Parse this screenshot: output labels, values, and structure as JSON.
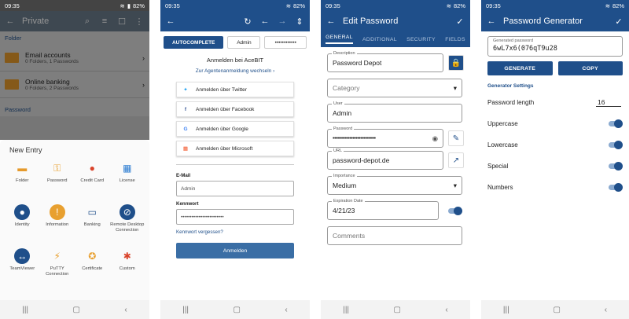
{
  "status": {
    "time": "09:35",
    "battery": "82%"
  },
  "screen1": {
    "title": "Private",
    "sections": {
      "folder": "Folder",
      "password": "Password"
    },
    "folders": [
      {
        "name": "Email accounts",
        "info": "0 Folders, 1 Passwords"
      },
      {
        "name": "Online banking",
        "info": "0 Folders, 2 Passwords"
      }
    ],
    "sheet_title": "New Entry",
    "entries": [
      {
        "label": "Folder",
        "icon": "folder-icon",
        "color": "#e59a2c"
      },
      {
        "label": "Password",
        "icon": "key-icon",
        "color": "#e8a030"
      },
      {
        "label": "Credit Card",
        "icon": "credit-card-icon",
        "color": "#d9432b"
      },
      {
        "label": "License",
        "icon": "windows-logo-icon",
        "color": "#2d7dd2"
      },
      {
        "label": "Identity",
        "icon": "person-icon",
        "color": "#1f4f8a"
      },
      {
        "label": "Information",
        "icon": "info-exclamation-icon",
        "color": "#e8a030"
      },
      {
        "label": "Banking",
        "icon": "bank-card-icon",
        "color": "#1f4f8a"
      },
      {
        "label": "Remote Desktop\nConnection",
        "icon": "remote-desktop-icon",
        "color": "#1f4f8a"
      },
      {
        "label": "TeamViewer",
        "icon": "teamviewer-icon",
        "color": "#1f4f8a"
      },
      {
        "label": "PuTTY\nConnection",
        "icon": "putty-icon",
        "color": "#e8a030"
      },
      {
        "label": "Certificate",
        "icon": "certificate-icon",
        "color": "#e8a030"
      },
      {
        "label": "Custom",
        "icon": "custom-icon",
        "color": "#d9432b"
      }
    ]
  },
  "screen2": {
    "tab_autocomplete": "AUTOCOMPLETE",
    "tab_user": "Admin",
    "tab_password": "••••••••••••",
    "heading": "Anmelden bei AceBIT",
    "switch_link": "Zur Agentenanmeldung wechseln",
    "social": [
      {
        "label": "Anmelden über Twitter",
        "icon": "twitter-icon"
      },
      {
        "label": "Anmelden über Facebook",
        "icon": "facebook-icon"
      },
      {
        "label": "Anmelden über Google",
        "icon": "google-icon"
      },
      {
        "label": "Anmelden über Microsoft",
        "icon": "microsoft-icon"
      }
    ],
    "email_label": "E-Mail",
    "email_value": "Admin",
    "password_label": "Kennwort",
    "password_value": "••••••••••••••••••••••••",
    "forgot_link": "Kennwort vergessen?",
    "submit": "Anmelden"
  },
  "screen3": {
    "title": "Edit Password",
    "tabs": [
      "GENERAL",
      "ADDITIONAL",
      "SECURITY",
      "FIELDS"
    ],
    "description_label": "Description",
    "description": "Password Depot",
    "category_placeholder": "Category",
    "user_label": "User",
    "user": "Admin",
    "password_label": "Password",
    "password_mask": "••••••••••••••••••••••••••••",
    "url_label": "URL",
    "url": "password-depot.de",
    "importance_label": "Importance",
    "importance": "Medium",
    "expiration_label": "Expiration Date",
    "expiration": "4/21/23",
    "comments_placeholder": "Comments"
  },
  "screen4": {
    "title": "Password Generator",
    "generated_label": "Generated password",
    "generated": "6wL7x6(076qT9u28",
    "generate_btn": "GENERATE",
    "copy_btn": "COPY",
    "settings_title": "Generator Settings",
    "length_label": "Password length",
    "length": "16",
    "options": [
      {
        "label": "Uppercase",
        "on": true
      },
      {
        "label": "Lowercase",
        "on": true
      },
      {
        "label": "Special",
        "on": true
      },
      {
        "label": "Numbers",
        "on": true
      }
    ]
  }
}
